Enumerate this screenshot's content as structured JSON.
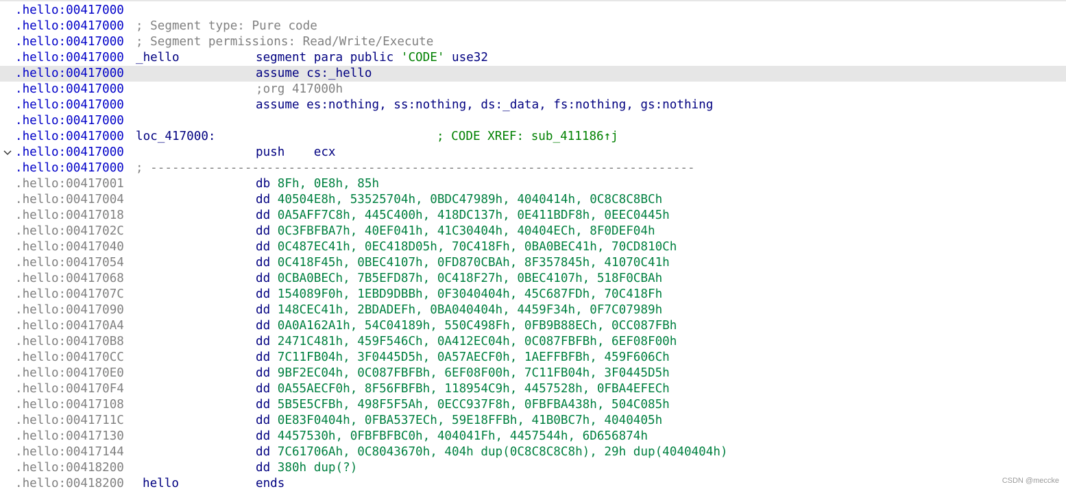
{
  "colors": {
    "code_address": "#0000c8",
    "data_address": "#808080",
    "mnemonic": "#000080",
    "number": "#008040",
    "comment": "#808080",
    "xref": "#008000",
    "selection": "#e6e6e6"
  },
  "lines": [
    {
      "addr": ".hello:00417000"
    },
    {
      "addr": ".hello:00417000",
      "comment": "; Segment type: Pure code"
    },
    {
      "addr": ".hello:00417000",
      "comment": "; Segment permissions: Read/Write/Execute"
    },
    {
      "addr": ".hello:00417000",
      "label": "_hello",
      "mn": "segment para public",
      "str": "'CODE'",
      "rest": "use32"
    },
    {
      "addr": ".hello:00417000",
      "mn": "assume cs:_hello"
    },
    {
      "addr": ".hello:00417000",
      "cmt": ";org 417000h"
    },
    {
      "addr": ".hello:00417000",
      "mn": "assume es:nothing, ss:nothing, ds:_data, fs:nothing, gs:nothing"
    },
    {
      "addr": ".hello:00417000"
    },
    {
      "addr": ".hello:00417000",
      "label": "loc_417000:",
      "xref": "; CODE XREF: sub_411186↑j"
    },
    {
      "addr": ".hello:00417000",
      "mn": "push",
      "ops": "ecx",
      "gutter_icon": "chevron-down-icon"
    },
    {
      "addr": ".hello:00417000",
      "comment": "; ---------------------------------------------------------------------------"
    },
    {
      "addr": ".hello:00417001",
      "mn": "db",
      "ops": "8Fh, 0E8h, 85h"
    },
    {
      "addr": ".hello:00417004",
      "mn": "dd",
      "ops": "40504E8h, 53525704h, 0BDC47989h, 4040414h, 0C8C8C8BCh"
    },
    {
      "addr": ".hello:00417018",
      "mn": "dd",
      "ops": "0A5AFF7C8h, 445C400h, 418DC137h, 0E411BDF8h, 0EEC0445h"
    },
    {
      "addr": ".hello:0041702C",
      "mn": "dd",
      "ops": "0C3FBFBA7h, 40EF041h, 41C30404h, 40404ECh, 8F0DEF04h"
    },
    {
      "addr": ".hello:00417040",
      "mn": "dd",
      "ops": "0C487EC41h, 0EC418D05h, 70C418Fh, 0BA0BEC41h, 70CD810Ch"
    },
    {
      "addr": ".hello:00417054",
      "mn": "dd",
      "ops": "0C418F45h, 0BEC4107h, 0FD870CBAh, 8F357845h, 41070C41h"
    },
    {
      "addr": ".hello:00417068",
      "mn": "dd",
      "ops": "0CBA0BECh, 7B5EFD87h, 0C418F27h, 0BEC4107h, 518F0CBAh"
    },
    {
      "addr": ".hello:0041707C",
      "mn": "dd",
      "ops": "154089F0h, 1EBD9DBBh, 0F3040404h, 45C687FDh, 70C418Fh"
    },
    {
      "addr": ".hello:00417090",
      "mn": "dd",
      "ops": "148CEC41h, 2BDADEFh, 0BA040404h, 4459F34h, 0F7C07989h"
    },
    {
      "addr": ".hello:004170A4",
      "mn": "dd",
      "ops": "0A0A162A1h, 54C04189h, 550C498Fh, 0FB9B88ECh, 0CC087FBh"
    },
    {
      "addr": ".hello:004170B8",
      "mn": "dd",
      "ops": "2471C481h, 459F546Ch, 0A412EC04h, 0C087FBFBh, 6EF08F00h"
    },
    {
      "addr": ".hello:004170CC",
      "mn": "dd",
      "ops": "7C11FB04h, 3F0445D5h, 0A57AECF0h, 1AEFFBFBh, 459F606Ch"
    },
    {
      "addr": ".hello:004170E0",
      "mn": "dd",
      "ops": "9BF2EC04h, 0C087FBFBh, 6EF08F00h, 7C11FB04h, 3F0445D5h"
    },
    {
      "addr": ".hello:004170F4",
      "mn": "dd",
      "ops": "0A55AECF0h, 8F56FBFBh, 118954C9h, 4457528h, 0FBA4EFECh"
    },
    {
      "addr": ".hello:00417108",
      "mn": "dd",
      "ops": "5B5E5CFBh, 498F5F5Ah, 0ECC937F8h, 0FBFBA438h, 504C085h"
    },
    {
      "addr": ".hello:0041711C",
      "mn": "dd",
      "ops": "0E83F0404h, 0FBA537ECh, 59E18FFBh, 41B0BC7h, 4040405h"
    },
    {
      "addr": ".hello:00417130",
      "mn": "dd",
      "ops": "4457530h, 0FBFBFBC0h, 404041Fh, 4457544h, 6D656874h"
    },
    {
      "addr": ".hello:00417144",
      "mn": "dd",
      "ops": "7C61706Ah, 0C8043670h, 404h dup(0C8C8C8C8h), 29h dup(4040404h)"
    },
    {
      "addr": ".hello:00418200",
      "mn": "dd",
      "ops": "380h dup(?)"
    },
    {
      "addr": ".hello:00418200",
      "label": "hello",
      "mn": "ends"
    }
  ],
  "watermark": "CSDN @meccke"
}
